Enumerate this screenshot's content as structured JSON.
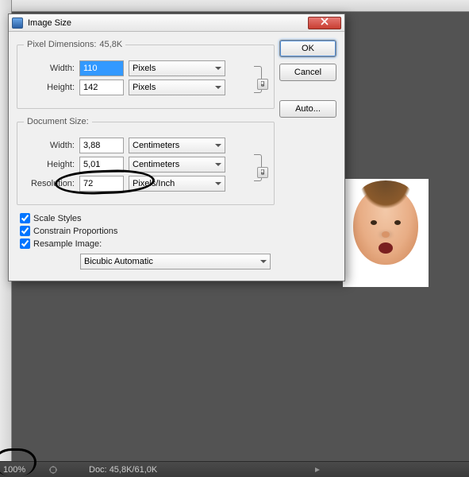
{
  "dialog": {
    "title": "Image Size",
    "pixel_dimensions": {
      "legend": "Pixel Dimensions:",
      "size": "45,8K",
      "width_label": "Width:",
      "width_value": "110",
      "width_unit": "Pixels",
      "height_label": "Height:",
      "height_value": "142",
      "height_unit": "Pixels"
    },
    "document_size": {
      "legend": "Document Size:",
      "width_label": "Width:",
      "width_value": "3,88",
      "width_unit": "Centimeters",
      "height_label": "Height:",
      "height_value": "5,01",
      "height_unit": "Centimeters",
      "resolution_label": "Resolution:",
      "resolution_value": "72",
      "resolution_unit": "Pixels/Inch"
    },
    "checks": {
      "scale_styles": "Scale Styles",
      "constrain": "Constrain Proportions",
      "resample": "Resample Image:"
    },
    "resample_method": "Bicubic Automatic",
    "buttons": {
      "ok": "OK",
      "cancel": "Cancel",
      "auto": "Auto..."
    }
  },
  "statusbar": {
    "zoom": "100%",
    "doc_label": "Doc:",
    "doc_value": "45,8K/61,0K"
  }
}
